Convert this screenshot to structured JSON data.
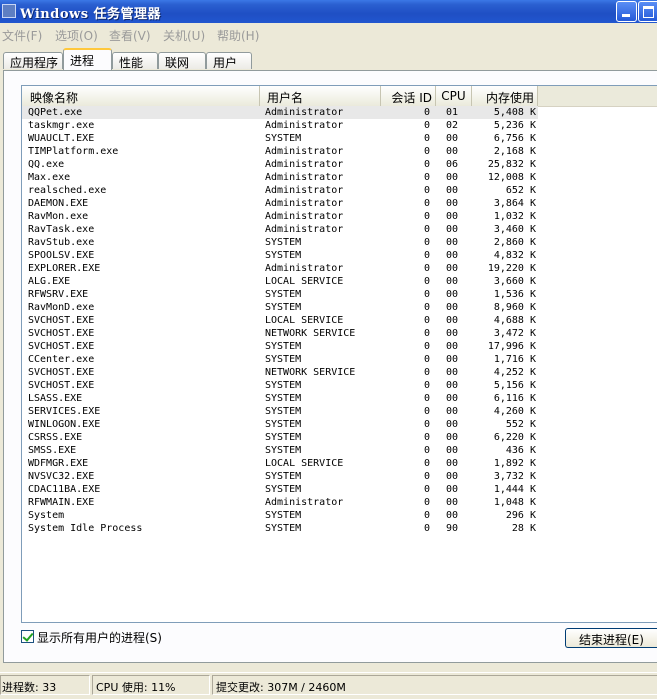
{
  "window": {
    "title": "Windows 任务管理器"
  },
  "menu": [
    "文件(F)",
    "选项(O)",
    "查看(V)",
    "关机(U)",
    "帮助(H)"
  ],
  "tabs": [
    "应用程序",
    "进程",
    "性能",
    "联网",
    "用户"
  ],
  "active_tab": "进程",
  "columns": {
    "name": "映像名称",
    "user": "用户名",
    "session": "会话 ID",
    "cpu": "CPU",
    "mem": "内存使用"
  },
  "processes": [
    {
      "name": "QQPet.exe",
      "user": "Administrator",
      "session": "0",
      "cpu": "01",
      "mem": "5,408 K"
    },
    {
      "name": "taskmgr.exe",
      "user": "Administrator",
      "session": "0",
      "cpu": "02",
      "mem": "5,236 K"
    },
    {
      "name": "WUAUCLT.EXE",
      "user": "SYSTEM",
      "session": "0",
      "cpu": "00",
      "mem": "6,756 K"
    },
    {
      "name": "TIMPlatform.exe",
      "user": "Administrator",
      "session": "0",
      "cpu": "00",
      "mem": "2,168 K"
    },
    {
      "name": "QQ.exe",
      "user": "Administrator",
      "session": "0",
      "cpu": "06",
      "mem": "25,832 K"
    },
    {
      "name": "Max.exe",
      "user": "Administrator",
      "session": "0",
      "cpu": "00",
      "mem": "12,008 K"
    },
    {
      "name": "realsched.exe",
      "user": "Administrator",
      "session": "0",
      "cpu": "00",
      "mem": "652 K"
    },
    {
      "name": "DAEMON.EXE",
      "user": "Administrator",
      "session": "0",
      "cpu": "00",
      "mem": "3,864 K"
    },
    {
      "name": "RavMon.exe",
      "user": "Administrator",
      "session": "0",
      "cpu": "00",
      "mem": "1,032 K"
    },
    {
      "name": "RavTask.exe",
      "user": "Administrator",
      "session": "0",
      "cpu": "00",
      "mem": "3,460 K"
    },
    {
      "name": "RavStub.exe",
      "user": "SYSTEM",
      "session": "0",
      "cpu": "00",
      "mem": "2,860 K"
    },
    {
      "name": "SPOOLSV.EXE",
      "user": "SYSTEM",
      "session": "0",
      "cpu": "00",
      "mem": "4,832 K"
    },
    {
      "name": "EXPLORER.EXE",
      "user": "Administrator",
      "session": "0",
      "cpu": "00",
      "mem": "19,220 K"
    },
    {
      "name": "ALG.EXE",
      "user": "LOCAL SERVICE",
      "session": "0",
      "cpu": "00",
      "mem": "3,660 K"
    },
    {
      "name": "RFWSRV.EXE",
      "user": "SYSTEM",
      "session": "0",
      "cpu": "00",
      "mem": "1,536 K"
    },
    {
      "name": "RavMonD.exe",
      "user": "SYSTEM",
      "session": "0",
      "cpu": "00",
      "mem": "8,960 K"
    },
    {
      "name": "SVCHOST.EXE",
      "user": "LOCAL SERVICE",
      "session": "0",
      "cpu": "00",
      "mem": "4,688 K"
    },
    {
      "name": "SVCHOST.EXE",
      "user": "NETWORK SERVICE",
      "session": "0",
      "cpu": "00",
      "mem": "3,472 K"
    },
    {
      "name": "SVCHOST.EXE",
      "user": "SYSTEM",
      "session": "0",
      "cpu": "00",
      "mem": "17,996 K"
    },
    {
      "name": "CCenter.exe",
      "user": "SYSTEM",
      "session": "0",
      "cpu": "00",
      "mem": "1,716 K"
    },
    {
      "name": "SVCHOST.EXE",
      "user": "NETWORK SERVICE",
      "session": "0",
      "cpu": "00",
      "mem": "4,252 K"
    },
    {
      "name": "SVCHOST.EXE",
      "user": "SYSTEM",
      "session": "0",
      "cpu": "00",
      "mem": "5,156 K"
    },
    {
      "name": "LSASS.EXE",
      "user": "SYSTEM",
      "session": "0",
      "cpu": "00",
      "mem": "6,116 K"
    },
    {
      "name": "SERVICES.EXE",
      "user": "SYSTEM",
      "session": "0",
      "cpu": "00",
      "mem": "4,260 K"
    },
    {
      "name": "WINLOGON.EXE",
      "user": "SYSTEM",
      "session": "0",
      "cpu": "00",
      "mem": "552 K"
    },
    {
      "name": "CSRSS.EXE",
      "user": "SYSTEM",
      "session": "0",
      "cpu": "00",
      "mem": "6,220 K"
    },
    {
      "name": "SMSS.EXE",
      "user": "SYSTEM",
      "session": "0",
      "cpu": "00",
      "mem": "436 K"
    },
    {
      "name": "WDFMGR.EXE",
      "user": "LOCAL SERVICE",
      "session": "0",
      "cpu": "00",
      "mem": "1,892 K"
    },
    {
      "name": "NVSVC32.EXE",
      "user": "SYSTEM",
      "session": "0",
      "cpu": "00",
      "mem": "3,732 K"
    },
    {
      "name": "CDAC11BA.EXE",
      "user": "SYSTEM",
      "session": "0",
      "cpu": "00",
      "mem": "1,444 K"
    },
    {
      "name": "RFWMAIN.EXE",
      "user": "Administrator",
      "session": "0",
      "cpu": "00",
      "mem": "1,048 K"
    },
    {
      "name": "System",
      "user": "SYSTEM",
      "session": "0",
      "cpu": "00",
      "mem": "296 K"
    },
    {
      "name": "System Idle Process",
      "user": "SYSTEM",
      "session": "0",
      "cpu": "90",
      "mem": "28 K"
    }
  ],
  "show_all_label": "显示所有用户的进程(S)",
  "show_all_checked": true,
  "end_process_label": "结束进程(E)",
  "status": {
    "processes": "进程数: 33",
    "cpu": "CPU 使用: 11%",
    "commit": "提交更改: 307M / 2460M"
  }
}
